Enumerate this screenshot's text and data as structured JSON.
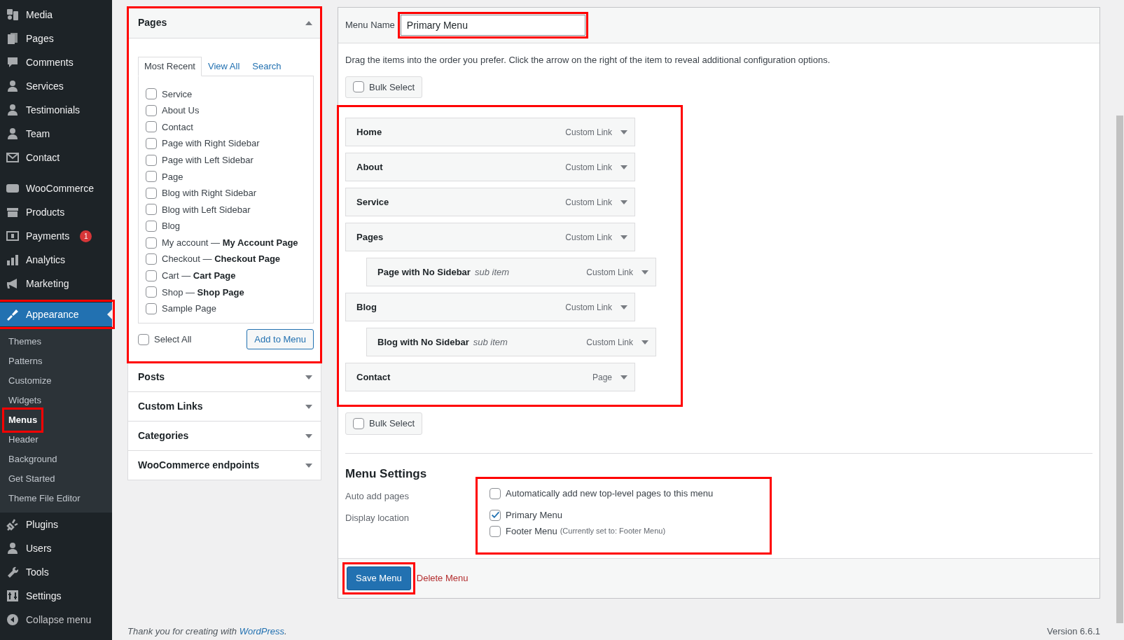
{
  "sidebar": {
    "groups": [
      [
        {
          "label": "Media",
          "selected": false
        },
        {
          "label": "Pages",
          "selected": false
        },
        {
          "label": "Comments",
          "selected": false
        },
        {
          "label": "Services",
          "selected": false
        },
        {
          "label": "Testimonials",
          "selected": false
        },
        {
          "label": "Team",
          "selected": false
        },
        {
          "label": "Contact",
          "selected": false
        }
      ],
      [
        {
          "label": "WooCommerce",
          "selected": false
        },
        {
          "label": "Products",
          "selected": false
        },
        {
          "label": "Payments",
          "selected": false,
          "badge": "1"
        },
        {
          "label": "Analytics",
          "selected": false
        },
        {
          "label": "Marketing",
          "selected": false
        }
      ],
      [
        {
          "label": "Appearance",
          "selected": true,
          "children": [
            {
              "label": "Themes",
              "selected": false
            },
            {
              "label": "Patterns",
              "selected": false
            },
            {
              "label": "Customize",
              "selected": false
            },
            {
              "label": "Widgets",
              "selected": false
            },
            {
              "label": "Menus",
              "selected": true
            },
            {
              "label": "Header",
              "selected": false
            },
            {
              "label": "Background",
              "selected": false
            },
            {
              "label": "Get Started",
              "selected": false
            },
            {
              "label": "Theme File Editor",
              "selected": false
            }
          ]
        },
        {
          "label": "Plugins",
          "selected": false
        },
        {
          "label": "Users",
          "selected": false
        },
        {
          "label": "Tools",
          "selected": false
        },
        {
          "label": "Settings",
          "selected": false
        }
      ]
    ],
    "collapse_label": "Collapse menu"
  },
  "add_items": [
    {
      "title": "Pages",
      "expanded": true,
      "tabs": [
        {
          "label": "Most Recent",
          "selected": true
        },
        {
          "label": "View All",
          "selected": false
        },
        {
          "label": "Search",
          "selected": false
        }
      ],
      "items": [
        {
          "label": "Service",
          "checked": false
        },
        {
          "label": "About Us",
          "checked": false
        },
        {
          "label": "Contact",
          "checked": false
        },
        {
          "label": "Page with Right Sidebar",
          "checked": false
        },
        {
          "label": "Page with Left Sidebar",
          "checked": false
        },
        {
          "label": "Page",
          "checked": false
        },
        {
          "label": "Blog with Right Sidebar",
          "checked": false
        },
        {
          "label": "Blog with Left Sidebar",
          "checked": false
        },
        {
          "label": "Blog",
          "checked": false
        },
        {
          "label": "My account — **My Account Page**",
          "checked": false
        },
        {
          "label": "Checkout — **Checkout Page**",
          "checked": false
        },
        {
          "label": "Cart — **Cart Page**",
          "checked": false
        },
        {
          "label": "Shop — **Shop Page**",
          "checked": false
        },
        {
          "label": "Sample Page",
          "checked": false
        }
      ],
      "select_all": {
        "label": "Select All",
        "checked": false
      },
      "button": "Add to Menu"
    },
    {
      "title": "Posts",
      "expanded": false
    },
    {
      "title": "Custom Links",
      "expanded": false
    },
    {
      "title": "Categories",
      "expanded": false
    },
    {
      "title": "WooCommerce endpoints",
      "expanded": false
    }
  ],
  "menu": {
    "name_label": "Menu Name",
    "name_value": "Primary Menu",
    "instructions": "Drag the items into the order you prefer. Click the arrow on the right of the item to reveal additional configuration options.",
    "bulk_select_top": {
      "label": "Bulk Select",
      "checked": false
    },
    "items": [
      {
        "title": "Home",
        "type": "Custom Link"
      },
      {
        "title": "About",
        "type": "Custom Link"
      },
      {
        "title": "Service",
        "type": "Custom Link"
      },
      {
        "title": "Pages",
        "type": "Custom Link",
        "children": [
          {
            "title": "Page with No Sidebar",
            "note": "sub item",
            "type": "Custom Link"
          }
        ]
      },
      {
        "title": "Blog",
        "type": "Custom Link",
        "children": [
          {
            "title": "Blog with No Sidebar",
            "note": "sub item",
            "type": "Custom Link"
          }
        ]
      },
      {
        "title": "Contact",
        "type": "Page"
      }
    ],
    "bulk_select_bottom": {
      "label": "Bulk Select",
      "checked": false
    },
    "settings": {
      "heading": "Menu Settings",
      "rows": [
        {
          "label": "Auto add pages",
          "options": [
            {
              "label": "Automatically add new top-level pages to this menu",
              "checked": false
            }
          ]
        },
        {
          "label": "Display location",
          "options": [
            {
              "label": "Primary Menu",
              "checked": true
            },
            {
              "label": "Footer Menu",
              "note": "(Currently set to: Footer Menu)",
              "checked": false
            }
          ]
        }
      ]
    },
    "save_button": "Save Menu",
    "delete_link": "Delete Menu"
  },
  "footer": {
    "text": "Thank you for creating with ",
    "link": "WordPress",
    "after": ".",
    "version": "Version 6.6.1"
  }
}
